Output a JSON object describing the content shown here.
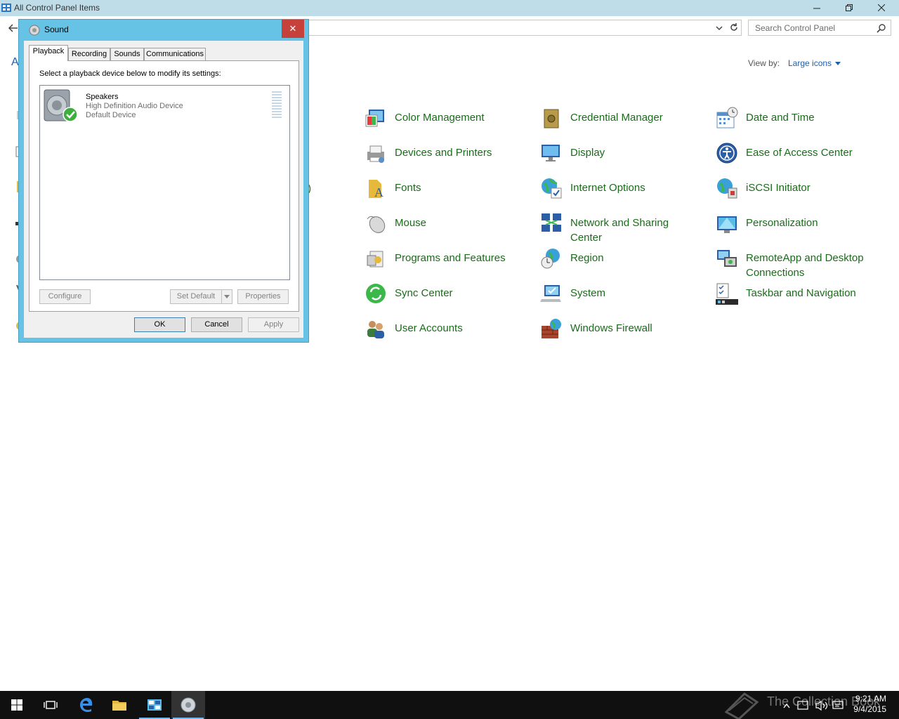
{
  "window": {
    "title": "All Control Panel Items",
    "search_placeholder": "Search Control Panel",
    "sidebar_letter": "A",
    "truncated_text": "t)"
  },
  "view_by": {
    "label": "View by:",
    "value": "Large icons"
  },
  "items": [
    {
      "label": "Color Management",
      "icon": "color-management-icon"
    },
    {
      "label": "Credential Manager",
      "icon": "credential-manager-icon"
    },
    {
      "label": "Date and Time",
      "icon": "date-time-icon"
    },
    {
      "label": "Devices and Printers",
      "icon": "devices-printers-icon"
    },
    {
      "label": "Display",
      "icon": "display-icon"
    },
    {
      "label": "Ease of Access Center",
      "icon": "ease-of-access-icon"
    },
    {
      "label": "Fonts",
      "icon": "fonts-icon"
    },
    {
      "label": "Internet Options",
      "icon": "internet-options-icon"
    },
    {
      "label": "iSCSI Initiator",
      "icon": "iscsi-icon"
    },
    {
      "label": "Mouse",
      "icon": "mouse-icon"
    },
    {
      "label": "Network and Sharing Center",
      "icon": "network-icon"
    },
    {
      "label": "Personalization",
      "icon": "personalization-icon"
    },
    {
      "label": "Programs and Features",
      "icon": "programs-icon"
    },
    {
      "label": "Region",
      "icon": "region-icon"
    },
    {
      "label": "RemoteApp and Desktop Connections",
      "icon": "remoteapp-icon"
    },
    {
      "label": "Sync Center",
      "icon": "sync-icon"
    },
    {
      "label": "System",
      "icon": "system-icon"
    },
    {
      "label": "Taskbar and Navigation",
      "icon": "taskbar-icon"
    },
    {
      "label": "User Accounts",
      "icon": "user-accounts-icon"
    },
    {
      "label": "Windows Firewall",
      "icon": "firewall-icon"
    }
  ],
  "dialog": {
    "title": "Sound",
    "close_label": "✕",
    "tabs": [
      "Playback",
      "Recording",
      "Sounds",
      "Communications"
    ],
    "active_tab": "Playback",
    "instruction": "Select a playback device below to modify its settings:",
    "device": {
      "name": "Speakers",
      "description": "High Definition Audio Device",
      "status": "Default Device"
    },
    "buttons": {
      "configure": "Configure",
      "set_default": "Set Default",
      "properties": "Properties",
      "ok": "OK",
      "cancel": "Cancel",
      "apply": "Apply"
    }
  },
  "taskbar": {
    "watermark": "The Collection Book",
    "time": "9:21 AM",
    "date": "9/4/2015"
  },
  "colors": {
    "link_green": "#1a6b1a",
    "link_blue": "#1e5dab",
    "dialog_frame": "#67c3e6",
    "close_red": "#c7413b",
    "taskbar": "#101010"
  }
}
